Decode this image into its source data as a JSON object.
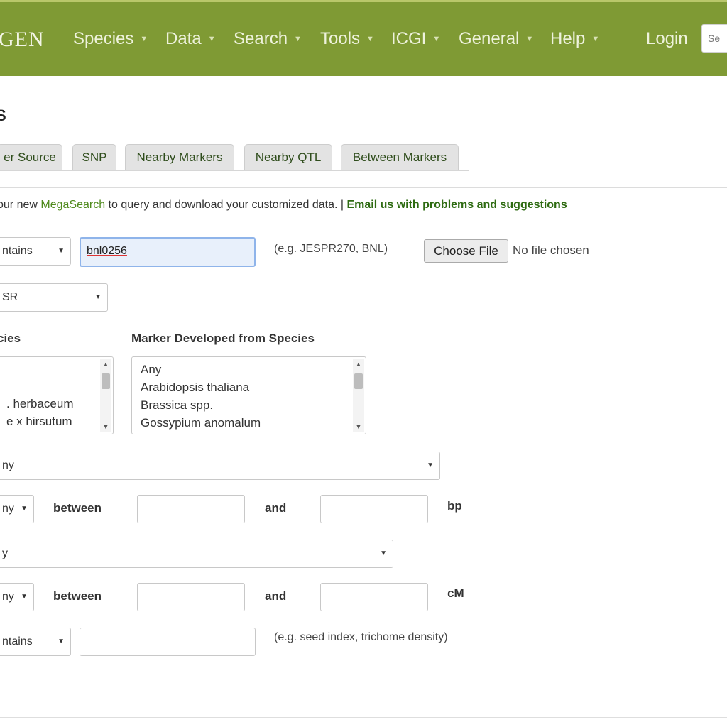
{
  "nav": {
    "logo": "GEN",
    "items": [
      {
        "label": "Species"
      },
      {
        "label": "Data"
      },
      {
        "label": "Search"
      },
      {
        "label": "Tools"
      },
      {
        "label": "ICGI"
      },
      {
        "label": "General"
      },
      {
        "label": "Help"
      }
    ],
    "login": "Login",
    "search_placeholder": "Se"
  },
  "page": {
    "title": "S",
    "tabs": [
      "er Source",
      "SNP",
      "Nearby Markers",
      "Nearby QTL",
      "Between Markers"
    ],
    "info": {
      "prefix": "our new ",
      "link": "MegaSearch",
      "middle": " to query and download your customized data. | ",
      "bold_link": "Email us with problems and suggestions"
    }
  },
  "form": {
    "name_row": {
      "operator": "ntains",
      "value": "bnl0256",
      "hint": "(e.g. JESPR270, BNL)",
      "choose_file": "Choose File",
      "no_file": "No file chosen"
    },
    "type_row": {
      "value": "SR"
    },
    "species_label": "cies",
    "species_options": [
      "",
      "",
      ". herbaceum",
      "e x hirsutum"
    ],
    "developed_label": "Marker Developed from Species",
    "developed_options": [
      "Any",
      "Arabidopsis thaliana",
      "Brassica spp.",
      "Gossypium anomalum"
    ],
    "map_row": {
      "value": "ny"
    },
    "bp_row": {
      "operator": "ny",
      "between": "between",
      "and": "and",
      "unit": "bp"
    },
    "map2_row": {
      "value": "y"
    },
    "cm_row": {
      "operator": "ny",
      "between": "between",
      "and": "and",
      "unit": "cM"
    },
    "trait_row": {
      "operator": "ntains",
      "hint": "(e.g. seed index, trichome density)"
    }
  }
}
